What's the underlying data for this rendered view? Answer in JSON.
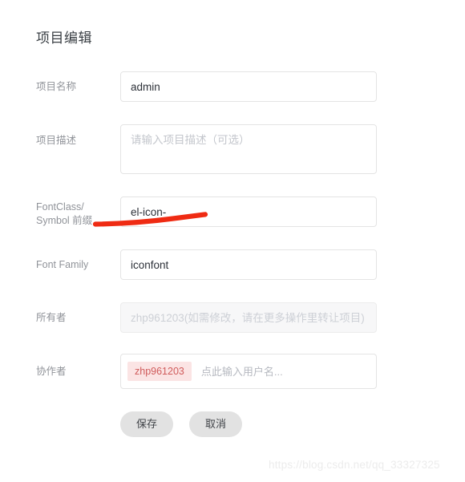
{
  "page": {
    "title": "项目编辑"
  },
  "form": {
    "fields": [
      {
        "label": "项目名称",
        "name": "project-name",
        "value": "admin",
        "placeholder": ""
      },
      {
        "label": "项目描述",
        "name": "project-description",
        "value": "",
        "placeholder": "请输入项目描述（可选）"
      },
      {
        "label_line1": "FontClass/",
        "label_line2": "Symbol 前缀",
        "name": "fontclass-prefix",
        "value": "el-icon-",
        "placeholder": ""
      },
      {
        "label": "Font Family",
        "name": "font-family",
        "value": "iconfont",
        "placeholder": ""
      },
      {
        "label": "所有者",
        "name": "owner",
        "value": "",
        "placeholder": "zhp961203(如需修改，请在更多操作里转让项目)",
        "disabled": true
      },
      {
        "label": "协作者",
        "name": "collaborators",
        "tag": "zhp961203",
        "placeholder": "点此输入用户名..."
      }
    ]
  },
  "buttons": {
    "save": "保存",
    "cancel": "取消"
  },
  "annotation": {
    "color": "#ef2b13"
  },
  "watermark": {
    "text": "https://blog.csdn.net/qq_33327325"
  },
  "colors": {
    "label": "#909399",
    "text": "#2c3038",
    "border": "#e4e4e4",
    "tag_bg": "#fbe4e4",
    "tag_text": "#d05c5c",
    "button_bg": "#e2e2e2",
    "annotation_red": "#ef2b13",
    "watermark": "#ececec"
  }
}
